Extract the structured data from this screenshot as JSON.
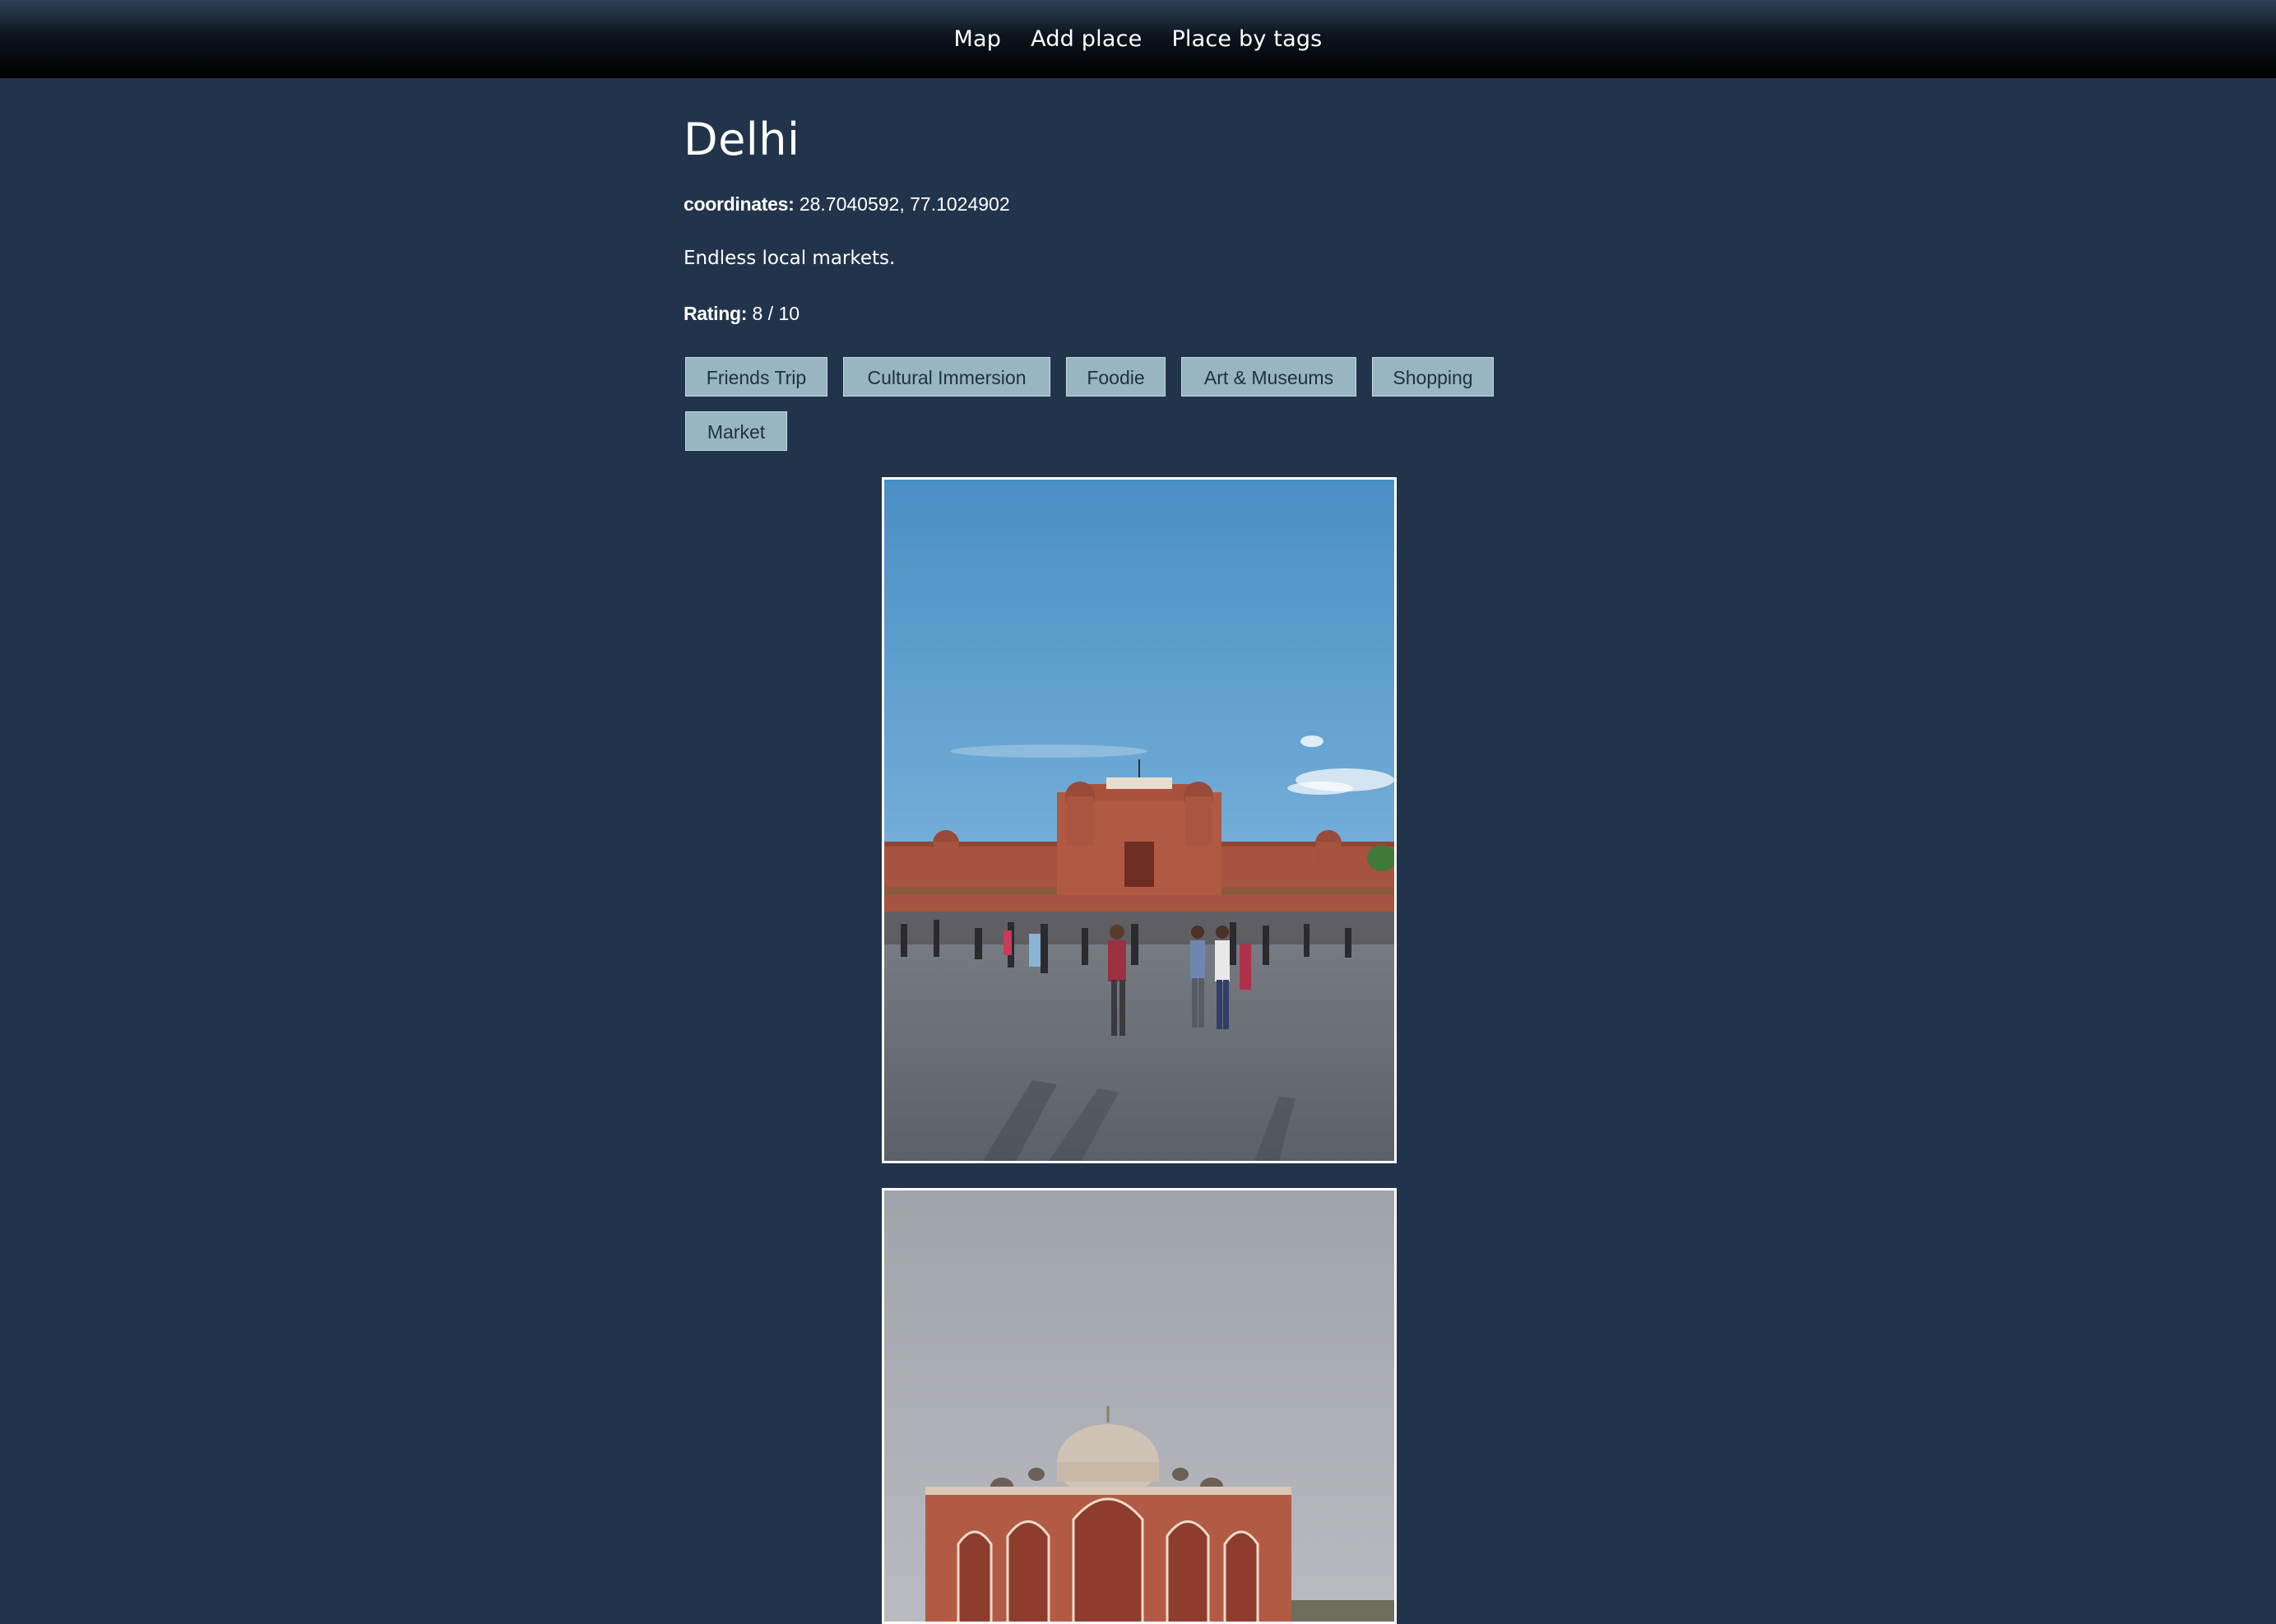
{
  "nav": {
    "items": [
      {
        "label": "Map"
      },
      {
        "label": "Add place"
      },
      {
        "label": "Place by tags"
      }
    ]
  },
  "place": {
    "name": "Delhi",
    "coordinates_label": "coordinates:",
    "coordinates_value": "28.7040592, 77.1024902",
    "description": "Endless local markets.",
    "rating_label": "Rating:",
    "rating_value": "8 / 10",
    "tags": [
      {
        "label": "Friends Trip"
      },
      {
        "label": "Cultural Immersion"
      },
      {
        "label": "Foodie"
      },
      {
        "label": "Art & Museums"
      },
      {
        "label": "Shopping"
      },
      {
        "label": "Market"
      }
    ]
  },
  "photos": [
    {
      "subject": "red-fort-crowd-photo"
    },
    {
      "subject": "humayun-tomb-photo"
    }
  ],
  "colors": {
    "background": "#22344b",
    "tag_bg": "#98b5c2",
    "tag_text": "#1f3042",
    "text": "#ffffff"
  }
}
